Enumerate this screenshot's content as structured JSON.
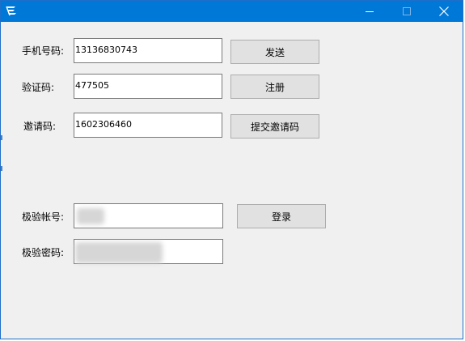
{
  "window": {
    "title_icon": "app-logo-icon",
    "controls": {
      "minimize_icon": "minimize-icon",
      "maximize_icon": "maximize-icon",
      "close_icon": "close-icon"
    },
    "accent": "#0078d7"
  },
  "form": {
    "phone": {
      "label": "手机号码:",
      "value": "13136830743"
    },
    "send_button": "发送",
    "code": {
      "label": "验证码:",
      "value": "477505"
    },
    "register_button": "注册",
    "invite": {
      "label": "邀请码:",
      "value": "1602306460"
    },
    "submit_invite_button": "提交邀请码",
    "account": {
      "label": "极验帐号:",
      "value": ""
    },
    "login_button": "登录",
    "password": {
      "label": "极验密码:",
      "value": ""
    }
  }
}
